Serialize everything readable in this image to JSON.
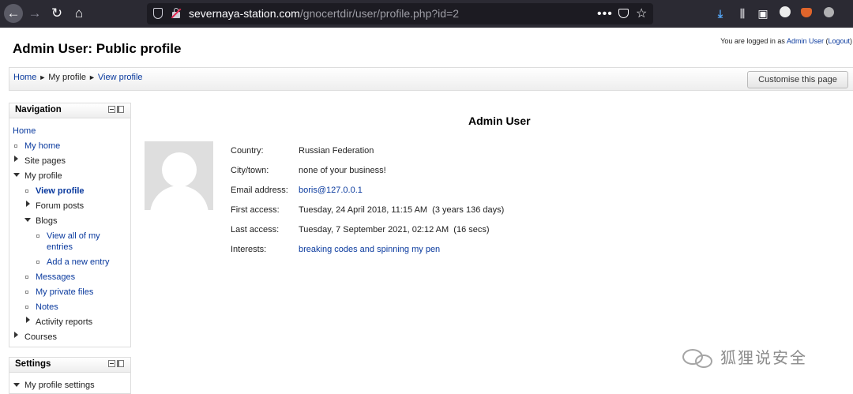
{
  "browser": {
    "url_domain": "severnaya-station.com",
    "url_path": "/gnocertdir/user/profile.php?id=2",
    "icons": [
      "back-icon",
      "forward-icon",
      "reload-icon",
      "home-icon",
      "shield-icon",
      "insecure-lock-icon",
      "more-icon",
      "pocket-icon",
      "bookmark-star-icon",
      "download-icon",
      "library-icon",
      "sidebar-icon",
      "account-icon",
      "extension-icon",
      "menu-icon"
    ]
  },
  "login": {
    "prefix": "You are logged in as",
    "user": "Admin User",
    "open_paren": "(",
    "logout": "Logout",
    "close_paren": ")"
  },
  "page_title": "Admin User: Public profile",
  "breadcrumb": [
    "Home",
    "My profile",
    "View profile"
  ],
  "breadcrumb_sep": "►",
  "customise_label": "Customise this page",
  "navigation": {
    "title": "Navigation",
    "items": {
      "home": "Home",
      "my_home": "My home",
      "site_pages": "Site pages",
      "my_profile": "My profile",
      "view_profile": "View profile",
      "forum_posts": "Forum posts",
      "blogs": "Blogs",
      "view_all_1": "View all of my",
      "view_all_2": "entries",
      "add_entry": "Add a new entry",
      "messages": "Messages",
      "private_files": "My private files",
      "notes": "Notes",
      "activity_reports": "Activity reports",
      "courses": "Courses"
    }
  },
  "settings": {
    "title": "Settings",
    "my_profile_settings": "My profile settings"
  },
  "profile": {
    "name": "Admin User",
    "rows": [
      {
        "label": "Country:",
        "value": "Russian Federation"
      },
      {
        "label": "City/town:",
        "value": "none of your business!"
      },
      {
        "label": "Email address:",
        "value": "boris@127.0.0.1"
      },
      {
        "label": "First access:",
        "value": "Tuesday, 24 April 2018, 11:15 AM  (3 years 136 days)"
      },
      {
        "label": "Last access:",
        "value": "Tuesday, 7 September 2021, 02:12 AM  (16 secs)"
      },
      {
        "label": "Interests:",
        "value": "breaking codes and spinning my pen"
      }
    ]
  },
  "watermark": "狐狸说安全"
}
